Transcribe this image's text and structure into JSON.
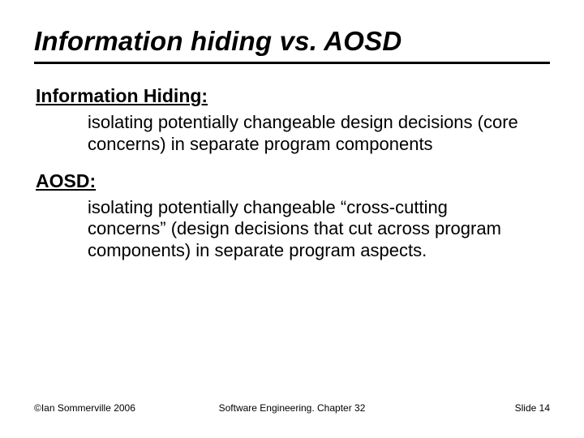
{
  "title": "Information hiding vs. AOSD",
  "sections": [
    {
      "heading": "Information Hiding:",
      "body": "isolating potentially changeable design decisions (core concerns) in separate program components"
    },
    {
      "heading": "AOSD:",
      "body": "isolating potentially changeable “cross-cutting concerns” (design decisions that cut across program components)  in separate program aspects."
    }
  ],
  "footer": {
    "left": "©Ian Sommerville 2006",
    "center": "Software Engineering. Chapter 32",
    "right": "Slide 14"
  }
}
